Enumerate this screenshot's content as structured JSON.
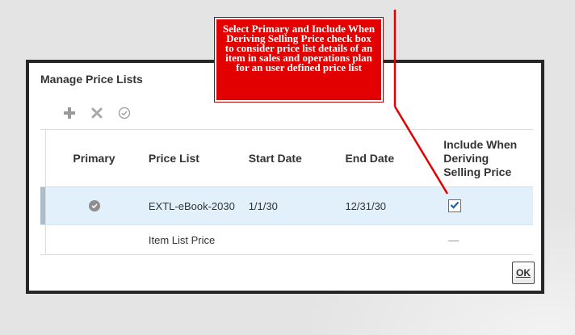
{
  "dialog": {
    "title": "Manage Price Lists",
    "toolbar": {
      "add_icon": "plus-icon",
      "delete_icon": "x-icon",
      "set_primary_icon": "check-circle-icon"
    },
    "columns": {
      "primary": "Primary",
      "price_list": "Price List",
      "start_date": "Start Date",
      "end_date": "End Date",
      "include": "Include When Deriving Selling Price"
    },
    "rows": [
      {
        "primary": true,
        "price_list": "EXTL-eBook-2030",
        "start_date": "1/1/30",
        "end_date": "12/31/30",
        "include": true,
        "selected": true
      },
      {
        "primary": false,
        "price_list": "Item List Price",
        "start_date": "",
        "end_date": "",
        "include": null,
        "include_placeholder": "—",
        "selected": false
      }
    ],
    "ok_label": "OK"
  },
  "callout": {
    "text": "Select Primary and Include When Deriving Selling Price check box to consider price list details of an item in sales and operations plan for an user defined price list",
    "color": "#e20000"
  },
  "colors": {
    "selected_row": "#e1f0fb",
    "dialog_border": "#262626",
    "checkbox_check": "#1f5fa8"
  }
}
